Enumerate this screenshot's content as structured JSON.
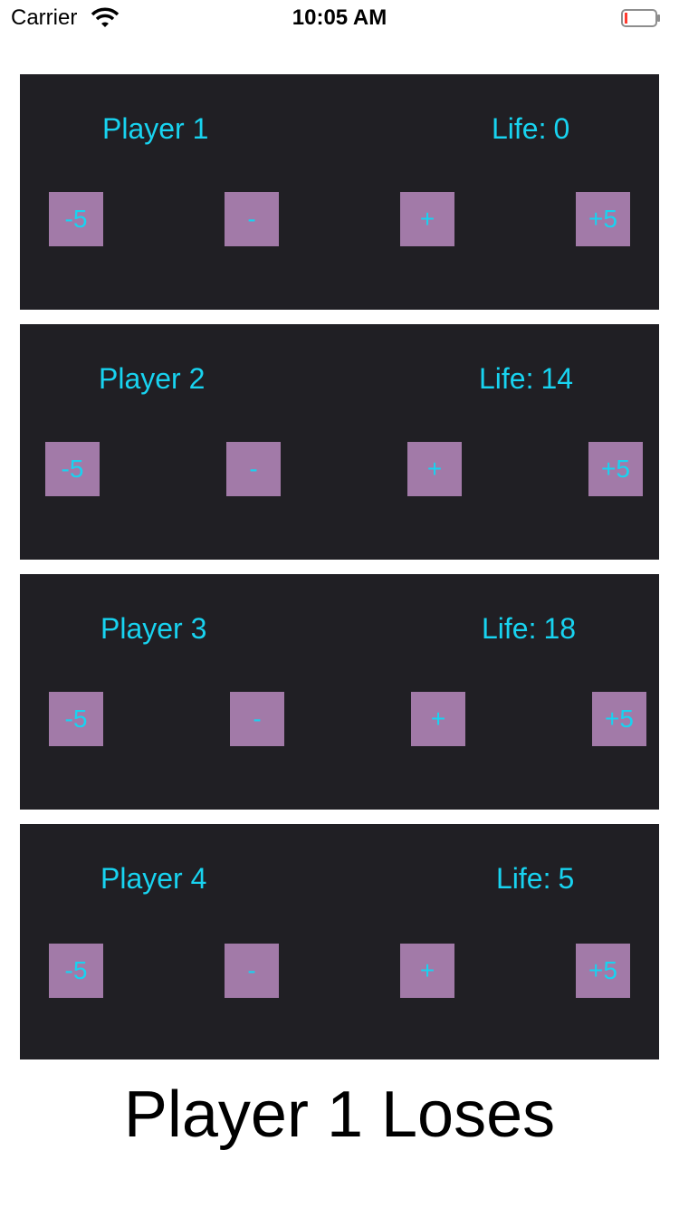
{
  "status_bar": {
    "carrier": "Carrier",
    "time": "10:05 AM"
  },
  "life_label": "Life:",
  "players": [
    {
      "name": "Player 1",
      "life": "0",
      "buttons": {
        "minus5": "-5",
        "minus": "-",
        "plus": "+",
        "plus5": "+5"
      }
    },
    {
      "name": "Player 2",
      "life": "14",
      "buttons": {
        "minus5": "-5",
        "minus": "-",
        "plus": "+",
        "plus5": "+5"
      }
    },
    {
      "name": "Player 3",
      "life": "18",
      "buttons": {
        "minus5": "-5",
        "minus": "-",
        "plus": "+",
        "plus5": "+5"
      }
    },
    {
      "name": "Player 4",
      "life": "5",
      "buttons": {
        "minus5": "-5",
        "minus": "-",
        "plus": "+",
        "plus5": "+5"
      }
    }
  ],
  "status_message": "Player 1 Loses",
  "colors": {
    "panel_bg": "#201f24",
    "accent_text": "#18d3f0",
    "button_bg": "#a27aa8"
  }
}
